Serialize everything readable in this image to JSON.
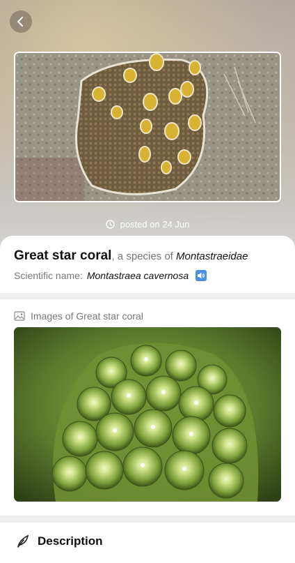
{
  "header": {
    "back_icon": "chevron-left-icon"
  },
  "post": {
    "posted_text": "posted on 24 Jun",
    "clock_icon": "clock-icon"
  },
  "species": {
    "common_name": "Great star coral",
    "species_of_text": ", a species of ",
    "family": "Montastraeidae",
    "scientific_label": "Scientific name:",
    "scientific_name": "Montastraea cavernosa",
    "speaker_icon": "speaker-icon"
  },
  "images_section": {
    "heading": "Images of Great star coral",
    "icon": "image-icon"
  },
  "description_section": {
    "heading": "Description",
    "icon": "feather-icon"
  },
  "colors": {
    "accent": "#4a90e2",
    "card_bg": "#ffffff",
    "page_bg": "#efefef"
  }
}
